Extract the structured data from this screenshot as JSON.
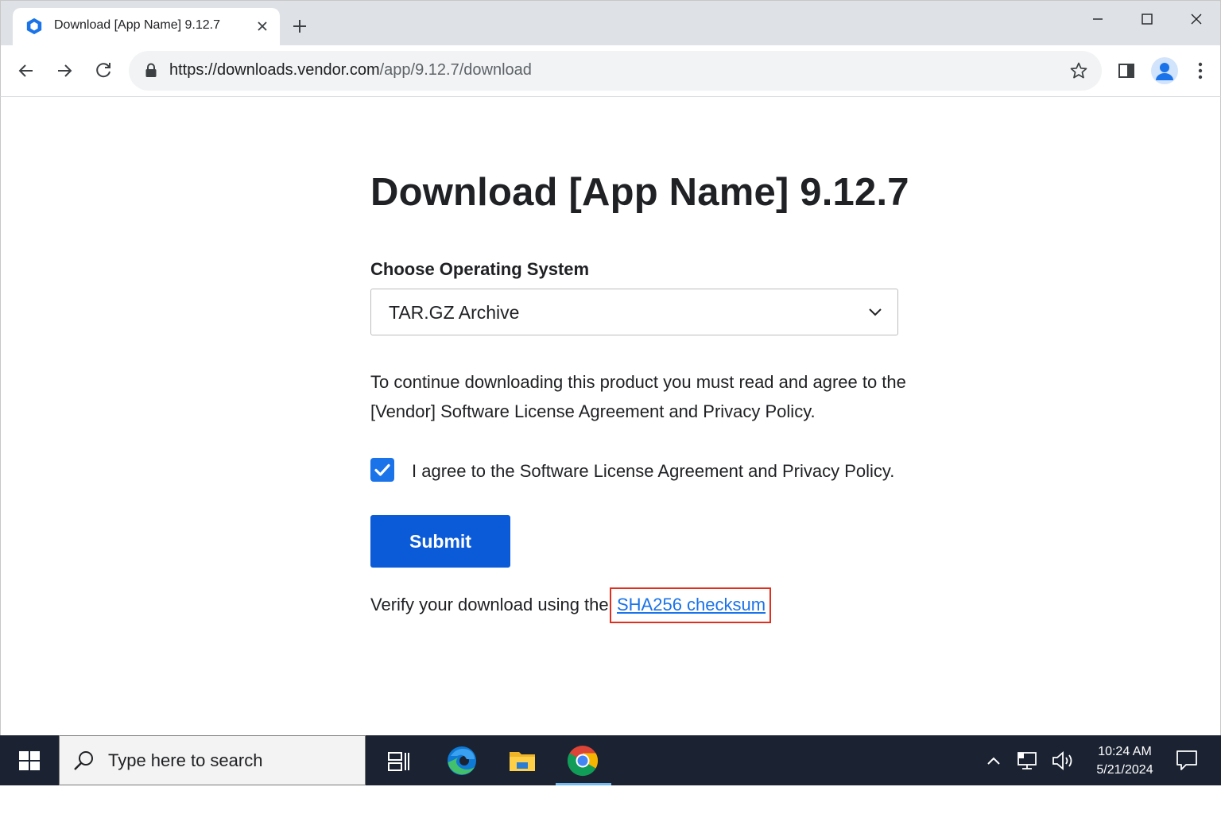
{
  "browser": {
    "tab_title": "Download [App Name] 9.12.7",
    "url_host": "https://downloads.vendor.com",
    "url_path": "/app/9.12.7/download",
    "accent": "#1a73e8"
  },
  "page": {
    "title": "Download [App Name] 9.12.7",
    "os_label": "Choose Operating System",
    "os_selected": "TAR.GZ Archive",
    "notice": "To continue downloading this product you must read and agree to the [Vendor] Software License Agreement and Privacy Policy.",
    "agree_checked": true,
    "agree_label": "I agree to the Software License Agreement and Privacy Policy.",
    "submit_label": "Submit",
    "submit_color": "#0b5bd8",
    "verify_text": "Verify your download using the",
    "checksum_link": "SHA256 checksum",
    "highlight_color": "#e02f1f"
  },
  "taskbar": {
    "search_placeholder": "Type here to search",
    "time": "10:24 AM",
    "date": "5/21/2024",
    "pinned": [
      "task-view-icon",
      "edge-icon",
      "file-explorer-icon",
      "chrome-icon"
    ],
    "active_app": "chrome-icon"
  }
}
